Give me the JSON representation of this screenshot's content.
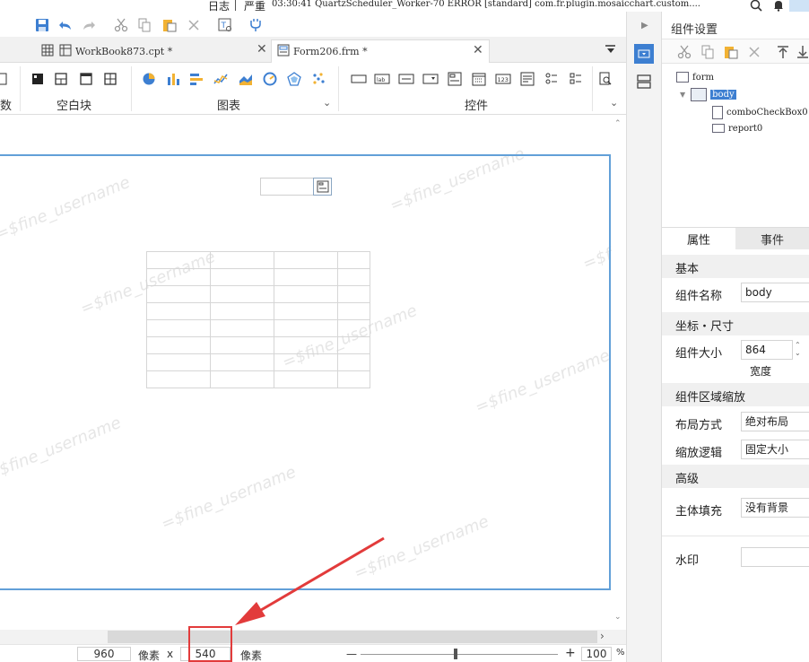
{
  "logbar": {
    "label": "日志",
    "severity": "严重",
    "message": "03:30:41 QuartzScheduler_Worker-70 ERROR [standard] com.fr.plugin.mosaicchart.custom...."
  },
  "tabs": [
    {
      "label": "WorkBook873.cpt *"
    },
    {
      "label": "Form206.frm *"
    }
  ],
  "palette": {
    "left_partial": "数",
    "blank_block": "空白块",
    "charts": "图表",
    "controls": "控件"
  },
  "statusbar": {
    "width_value": "960",
    "unit1": "像素",
    "times": "x",
    "height_value": "540",
    "unit2": "像素",
    "zoom_minus": "—",
    "zoom_plus": "+",
    "zoom_value": "100",
    "zoom_pct": "%"
  },
  "watermark": "=$fine_username",
  "panel": {
    "title": "组件设置",
    "tree": {
      "form": "form",
      "body": "body",
      "combo": "comboCheckBox0",
      "report": "report0"
    },
    "tabs": {
      "props": "属性",
      "events": "事件"
    },
    "sections": {
      "basic": "基本",
      "geom": "坐标・尺寸",
      "scale": "组件区域缩放",
      "advanced": "高级"
    },
    "props": {
      "name_label": "组件名称",
      "name_value": "body",
      "size_label": "组件大小",
      "size_value": "864",
      "width_label": "宽度",
      "layout_label": "布局方式",
      "layout_value": "绝对布局",
      "zoom_label": "缩放逻辑",
      "zoom_value": "固定大小",
      "fill_label": "主体填充",
      "fill_value": "没有背景",
      "watermark_label": "水印"
    }
  },
  "colors": {
    "accent": "#3d7fd1",
    "form_border": "#62a0d8",
    "highlight": "#e23b3b"
  }
}
